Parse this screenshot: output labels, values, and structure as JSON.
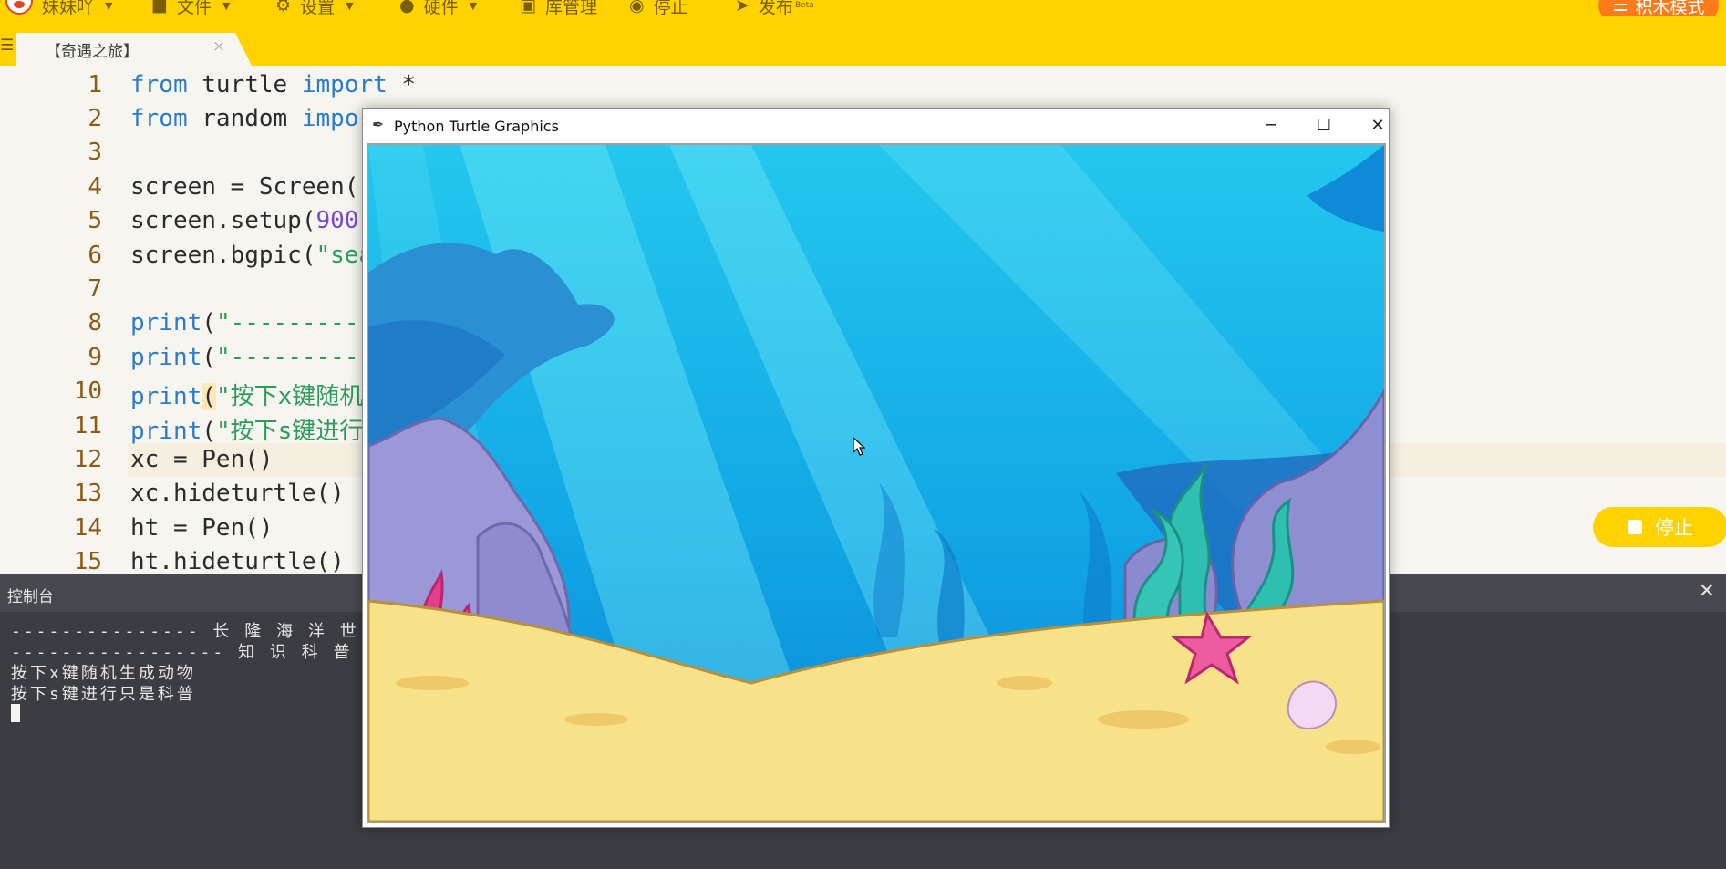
{
  "menu": {
    "user_label": "妹妹吖",
    "file_label": "文件",
    "settings_label": "设置",
    "hardware_label": "硬件",
    "library_label": "库管理",
    "stop_label": "停止",
    "publish_label": "发布",
    "publish_badge": "Beta",
    "blocks_mode_label": "积木模式",
    "accent_color": "#ffd200"
  },
  "tab": {
    "title": "【奇遇之旅】",
    "close_glyph": "×"
  },
  "editor": {
    "line_numbers": [
      "1",
      "2",
      "3",
      "4",
      "5",
      "6",
      "7",
      "8",
      "9",
      "10",
      "11",
      "12",
      "13",
      "14",
      "15"
    ],
    "current_line": 10
  },
  "code": {
    "l1_kw1": "from",
    "l1_mod": " turtle ",
    "l1_kw2": "import",
    "l1_rest": " *",
    "l2_kw1": "from",
    "l2_mod": " random ",
    "l2_kw2": "impor",
    "l4": "screen = Screen()",
    "l5_a": "screen.setup(",
    "l5_num": "900",
    "l5_b": ",",
    "l6_a": "screen.bgpic(",
    "l6_str": "\"sea",
    "l8_fn": "print",
    "l8_a": "(",
    "l8_str": "\"---------",
    "l9_fn": "print",
    "l9_a": "(",
    "l9_str": "\"---------",
    "l10_fn": "print",
    "l10_paren": "(",
    "l10_str": "\"按下x键随机",
    "l11_fn": "print",
    "l11_a": "(",
    "l11_str": "\"按下s键进行",
    "l12": "xc = Pen()",
    "l13": "xc.hideturtle()",
    "l14": "ht = Pen()",
    "l15": "ht.hideturtle()"
  },
  "run_stop_button": {
    "label": "停止"
  },
  "console": {
    "title": "控制台",
    "close_glyph": "✕",
    "lines": [
      "--------------- 长 隆 海 洋 世 界 ",
      "----------------- 知 识 科 普 ---",
      "按下x键随机生成动物",
      "按下s键进行只是科普"
    ]
  },
  "turtle_window": {
    "title": "Python Turtle Graphics",
    "minimize_glyph": "─",
    "maximize_glyph": "☐",
    "close_glyph": "✕"
  }
}
